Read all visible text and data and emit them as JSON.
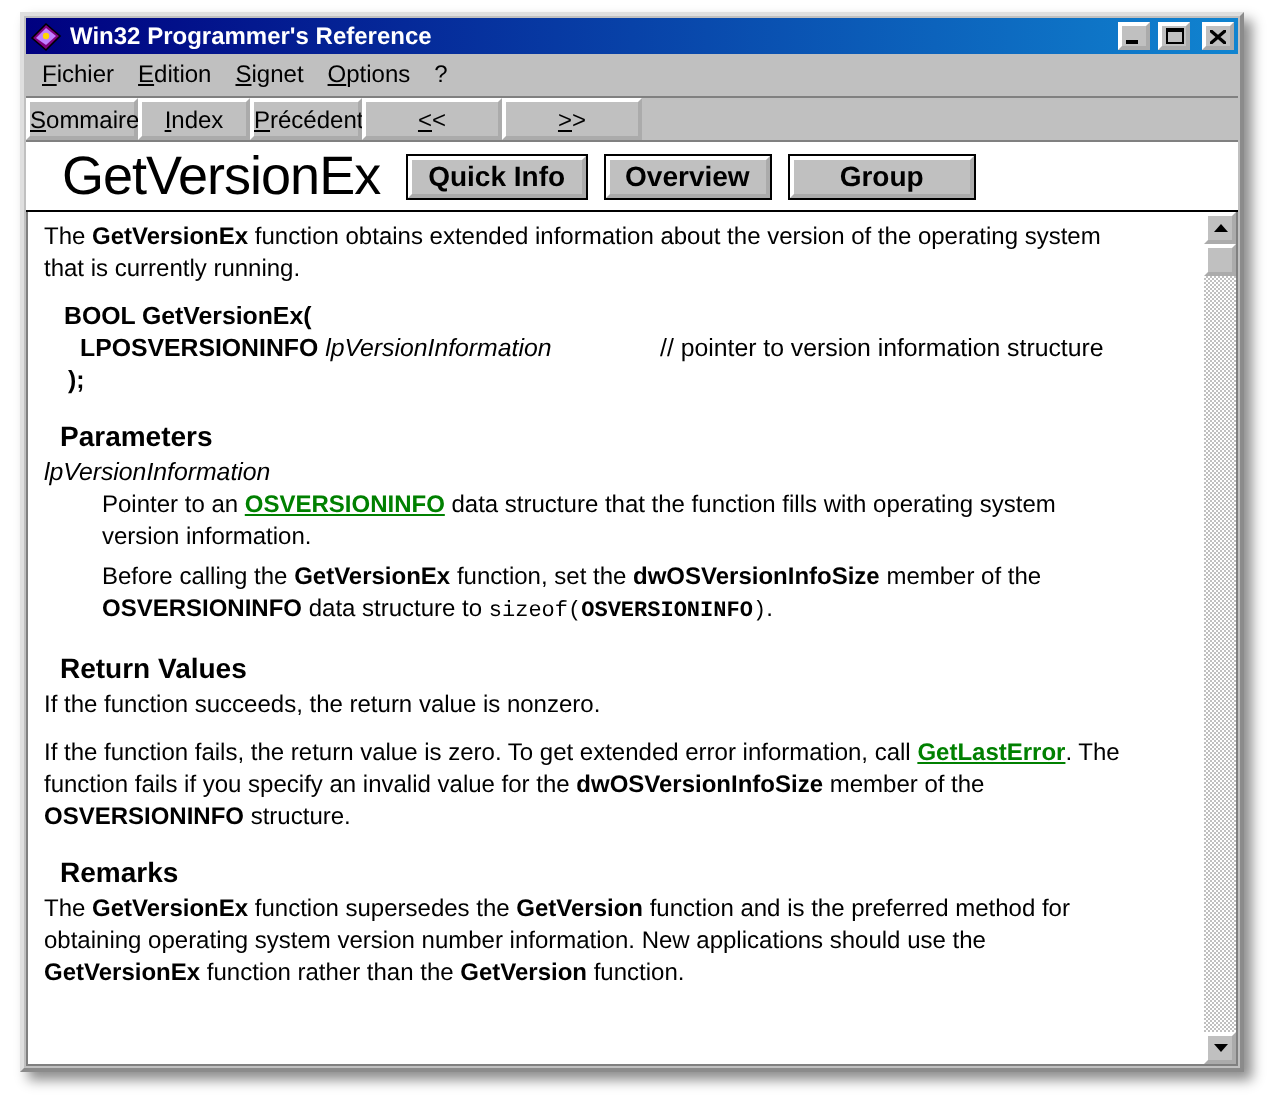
{
  "window": {
    "title": "Win32 Programmer's Reference"
  },
  "menu": [
    "Fichier",
    "Edition",
    "Signet",
    "Options",
    "?"
  ],
  "toolbar": [
    "Sommaire",
    "Index",
    "Précédent",
    "<<",
    ">>"
  ],
  "topic": {
    "title": "GetVersionEx",
    "buttons": [
      "Quick Info",
      "Overview",
      "Group"
    ]
  },
  "content": [
    {
      "kind": "paragraph",
      "parts": [
        {
          "kind": "text",
          "text": "The **GetVersionEx** function obtains extended information about the version of the operating system that is currently running."
        }
      ]
    },
    {
      "kind": "code",
      "lines": [
        {
          "text": "**BOOL GetVersionEx(**"
        },
        {
          "text": "**LPOSVERSIONINFO** *lpVersionInformation*",
          "comment": "// pointer to version information structure"
        },
        {
          "text": "**);**"
        }
      ]
    },
    {
      "kind": "heading",
      "text": "Parameters"
    },
    {
      "kind": "term",
      "text": "lpVersionInformation"
    },
    {
      "kind": "indented",
      "parts": [
        {
          "kind": "text",
          "text": "Pointer to an "
        },
        {
          "kind": "link",
          "text": "OSVERSIONINFO"
        },
        {
          "kind": "text",
          "text": " data structure that the function fills with operating system version information."
        }
      ]
    },
    {
      "kind": "indented",
      "parts": [
        {
          "kind": "text",
          "text": "Before calling the **GetVersionEx** function, set the **dwOSVersionInfoSize** member of the **OSVERSIONINFO** data structure to "
        },
        {
          "kind": "code",
          "text": "sizeof(**OSVERSIONINFO**)"
        },
        {
          "kind": "text",
          "text": "."
        }
      ]
    },
    {
      "kind": "heading",
      "text": "Return Values"
    },
    {
      "kind": "paragraph",
      "parts": [
        {
          "kind": "text",
          "text": "If the function succeeds, the return value is nonzero."
        }
      ]
    },
    {
      "kind": "paragraph",
      "parts": [
        {
          "kind": "text",
          "text": "If the function fails, the return value is zero. To get extended error information, call "
        },
        {
          "kind": "link",
          "text": "GetLastError"
        },
        {
          "kind": "text",
          "text": ". The function fails if you specify an invalid value for the **dwOSVersionInfoSize** member of the **OSVERSIONINFO** structure."
        }
      ]
    },
    {
      "kind": "heading",
      "text": "Remarks"
    },
    {
      "kind": "paragraph",
      "parts": [
        {
          "kind": "text",
          "text": "The **GetVersionEx** function supersedes the **GetVersion** function and is the preferred method for obtaining operating system version number information. New applications should use the **GetVersionEx** function rather than the **GetVersion** function."
        }
      ]
    }
  ]
}
